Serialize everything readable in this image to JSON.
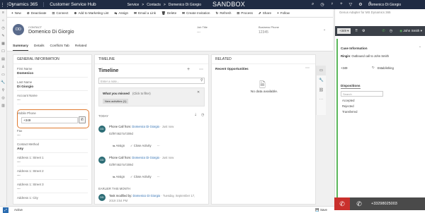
{
  "topbar": {
    "waffle": "⋮⋮⋮",
    "brand": "Dynamics 365",
    "app": "Customer Service Hub",
    "crumbs": [
      "Service",
      ">",
      "Contacts",
      ">",
      "Domenico Di Giorgio"
    ],
    "env": "SANDBOX",
    "icons": [
      "⌕",
      "◷",
      "♀",
      "+",
      "▽",
      "⚙",
      "?"
    ],
    "user": "Domenico Di Giorgio"
  },
  "cmdbar": [
    {
      "icon": "+",
      "label": "New"
    },
    {
      "icon": "⊘",
      "label": "Deactivate"
    },
    {
      "icon": "⊡",
      "label": "Connect"
    },
    {
      "icon": "⊕",
      "label": "Add to Marketing List"
    },
    {
      "icon": "⇆",
      "label": "Assign"
    },
    {
      "icon": "✉",
      "label": "Email a Link"
    },
    {
      "icon": "🗑",
      "label": "Delete"
    },
    {
      "icon": "✉",
      "label": "Create Invitation"
    },
    {
      "icon": "↻",
      "label": "Refresh"
    },
    {
      "icon": "⊟",
      "label": "Process"
    },
    {
      "icon": "⇗",
      "label": "Share"
    },
    {
      "icon": "+",
      "label": "Follow"
    }
  ],
  "header": {
    "initials": "DD",
    "type": "CONTACT",
    "name": "Domenico Di Giorgio",
    "job_title_label": "Job Title",
    "job_title_value": "---",
    "business_phone_label": "Business Phone",
    "business_phone_value": "12345"
  },
  "tabs": [
    "Summary",
    "Details",
    "Conflicts Tab",
    "Related"
  ],
  "general": {
    "title": "GENERAL INFORMATION",
    "first_name_label": "First Name",
    "first_name": "Domenico",
    "last_name_label": "Last Name",
    "last_name": "Di Giorgio",
    "account_name_label": "Account Name",
    "account_name": "---",
    "mobile_label": "Mobile Phone",
    "mobile_value": "+349",
    "fax_label": "Fax",
    "fax": "---",
    "contact_method_label": "Contact Method",
    "contact_method": "Any",
    "addr1_label": "Address 1: Street 1",
    "addr1": "---",
    "addr2_label": "Address 1: Street 2",
    "addr2": "---",
    "addr3_label": "Address 1: Street 3",
    "addr3": "---",
    "city_label": "Address 1: City"
  },
  "timeline": {
    "section": "TIMELINE",
    "title": "Timeline",
    "note_placeholder": "Enter a note...",
    "missed": "What you missed",
    "missed_filter": "(Click to filter)",
    "new_activities": "New activities (1)",
    "today": "TODAY",
    "earlier": "EARLIER THIS MONTH",
    "items": [
      {
        "initials": "DD",
        "title_prefix": "Phone Call from:",
        "from": "Domenico Di Giorgio",
        "time": "· Just now",
        "code": "02f974627a7209d",
        "assign": "Assign",
        "close": "Close Activity"
      },
      {
        "initials": "DD",
        "title_prefix": "Phone Call from:",
        "from": "Domenico Di Giorgio",
        "time": "· Just now",
        "code": "02f974627a7209d",
        "assign": "Assign",
        "close": "Close Activity"
      }
    ],
    "task": {
      "initials": "DD",
      "text": "Task modified by:",
      "by": "Domenico Di Giorgio",
      "time": "· Tuesday, September 17,",
      "time2": "2019 3:54 PM"
    }
  },
  "related": {
    "section": "RELATED",
    "recent": "Recent Opportunities",
    "empty": "No data available."
  },
  "status": {
    "state": "Active",
    "save": "Save"
  },
  "cif": {
    "header": "Genus Adapter for MS Dynamics 365",
    "agent": "John Smith",
    "agent_state_icon": "◉",
    "case_info": "Case Information",
    "ringin_label": "Ringin",
    "ringin_text": "Outbound call to John Smith",
    "call_num": "+349",
    "call_state": "Estab/ishing",
    "dispositions": "Dispositions",
    "search_placeholder": "Search",
    "disp_list": [
      "Accepted",
      "Rejected",
      "Transferred"
    ],
    "callbar_number": "+33298025003"
  }
}
